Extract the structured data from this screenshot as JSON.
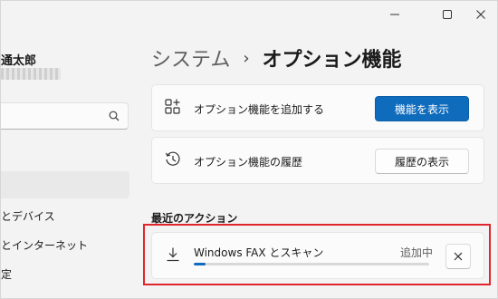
{
  "window": {
    "controls": {
      "minimize_icon": "minimize-icon",
      "maximize_icon": "maximize-icon",
      "close_icon": "close-icon"
    }
  },
  "sidebar": {
    "user_name": "通太郎",
    "search": {
      "placeholder": "",
      "icon": "search-icon"
    },
    "items": [
      {
        "label": ""
      },
      {
        "label": "とデバイス"
      },
      {
        "label": "とインターネット"
      },
      {
        "label": "定"
      }
    ]
  },
  "breadcrumb": {
    "parent": "システム",
    "separator": "›",
    "current": "オプション機能"
  },
  "cards": {
    "add_feature": {
      "label": "オプション機能を追加する",
      "button": "機能を表示",
      "icon": "add-feature-icon"
    },
    "history": {
      "label": "オプション機能の履歴",
      "button": "履歴の表示",
      "icon": "history-icon"
    }
  },
  "recent_actions": {
    "heading": "最近のアクション",
    "items": [
      {
        "name": "Windows FAX とスキャン",
        "status": "追加中",
        "progress": 0.05,
        "icon": "download-icon",
        "cancel_icon": "close-icon"
      }
    ]
  },
  "colors": {
    "accent": "#0f6cbd",
    "highlight": "#e0252c"
  }
}
